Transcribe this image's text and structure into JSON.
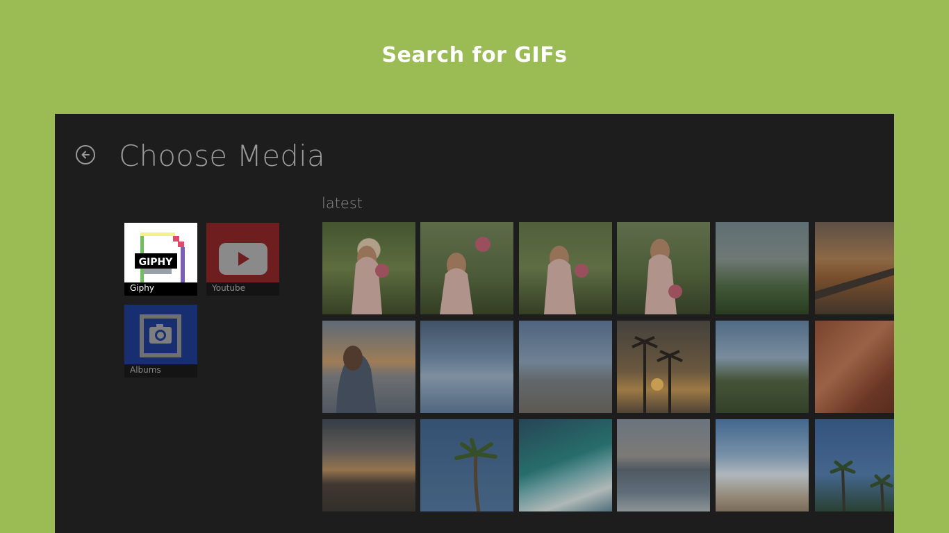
{
  "banner": {
    "title": "Search for GIFs"
  },
  "header": {
    "title": "Choose Media"
  },
  "sources": [
    {
      "label": "Giphy",
      "logo_text": "GIPHY",
      "color": "#ffffff",
      "selected": true
    },
    {
      "label": "Youtube",
      "color": "#7a2020",
      "selected": false
    },
    {
      "label": "Albums",
      "color": "#1c3b8c",
      "selected": false
    }
  ],
  "gallery": {
    "section_label": "latest"
  },
  "colors": {
    "page_background": "#9bbb55",
    "app_background": "#1d1d1d"
  }
}
